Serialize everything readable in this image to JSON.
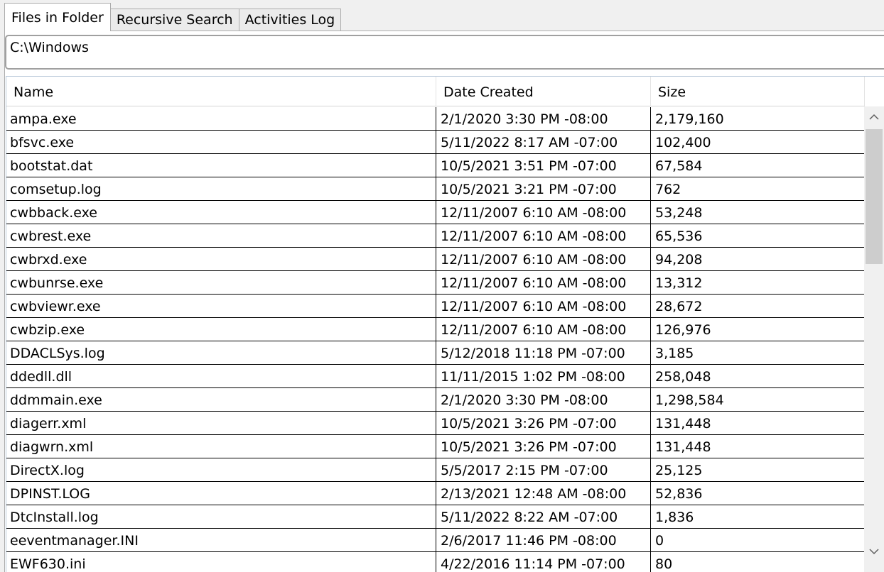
{
  "tabs": [
    {
      "label": "Files in Folder",
      "active": true
    },
    {
      "label": "Recursive Search",
      "active": false
    },
    {
      "label": "Activities Log",
      "active": false
    }
  ],
  "path": {
    "value": "C:\\Windows"
  },
  "table": {
    "columns": [
      "Name",
      "Date Created",
      "Size"
    ],
    "rows": [
      [
        "ampa.exe",
        "2/1/2020 3:30 PM -08:00",
        "2,179,160"
      ],
      [
        "bfsvc.exe",
        "5/11/2022 8:17 AM -07:00",
        "102,400"
      ],
      [
        "bootstat.dat",
        "10/5/2021 3:51 PM -07:00",
        "67,584"
      ],
      [
        "comsetup.log",
        "10/5/2021 3:21 PM -07:00",
        "762"
      ],
      [
        "cwbback.exe",
        "12/11/2007 6:10 AM -08:00",
        "53,248"
      ],
      [
        "cwbrest.exe",
        "12/11/2007 6:10 AM -08:00",
        "65,536"
      ],
      [
        "cwbrxd.exe",
        "12/11/2007 6:10 AM -08:00",
        "94,208"
      ],
      [
        "cwbunrse.exe",
        "12/11/2007 6:10 AM -08:00",
        "13,312"
      ],
      [
        "cwbviewr.exe",
        "12/11/2007 6:10 AM -08:00",
        "28,672"
      ],
      [
        "cwbzip.exe",
        "12/11/2007 6:10 AM -08:00",
        "126,976"
      ],
      [
        "DDACLSys.log",
        "5/12/2018 11:18 PM -07:00",
        "3,185"
      ],
      [
        "ddedll.dll",
        "11/11/2015 1:02 PM -08:00",
        "258,048"
      ],
      [
        "ddmmain.exe",
        "2/1/2020 3:30 PM -08:00",
        "1,298,584"
      ],
      [
        "diagerr.xml",
        "10/5/2021 3:26 PM -07:00",
        "131,448"
      ],
      [
        "diagwrn.xml",
        "10/5/2021 3:26 PM -07:00",
        "131,448"
      ],
      [
        "DirectX.log",
        "5/5/2017 2:15 PM -07:00",
        "25,125"
      ],
      [
        "DPINST.LOG",
        "2/13/2021 12:48 AM -08:00",
        "52,836"
      ],
      [
        "DtcInstall.log",
        "5/11/2022 8:22 AM -07:00",
        "1,836"
      ],
      [
        "eeventmanager.INI",
        "2/6/2017 11:46 PM -08:00",
        "0"
      ],
      [
        "EWF630.ini",
        "4/22/2016 11:14 PM -07:00",
        "80"
      ]
    ]
  },
  "scrollbar": {
    "up_icon": "chevron-up-icon",
    "down_icon": "chevron-down-icon"
  }
}
